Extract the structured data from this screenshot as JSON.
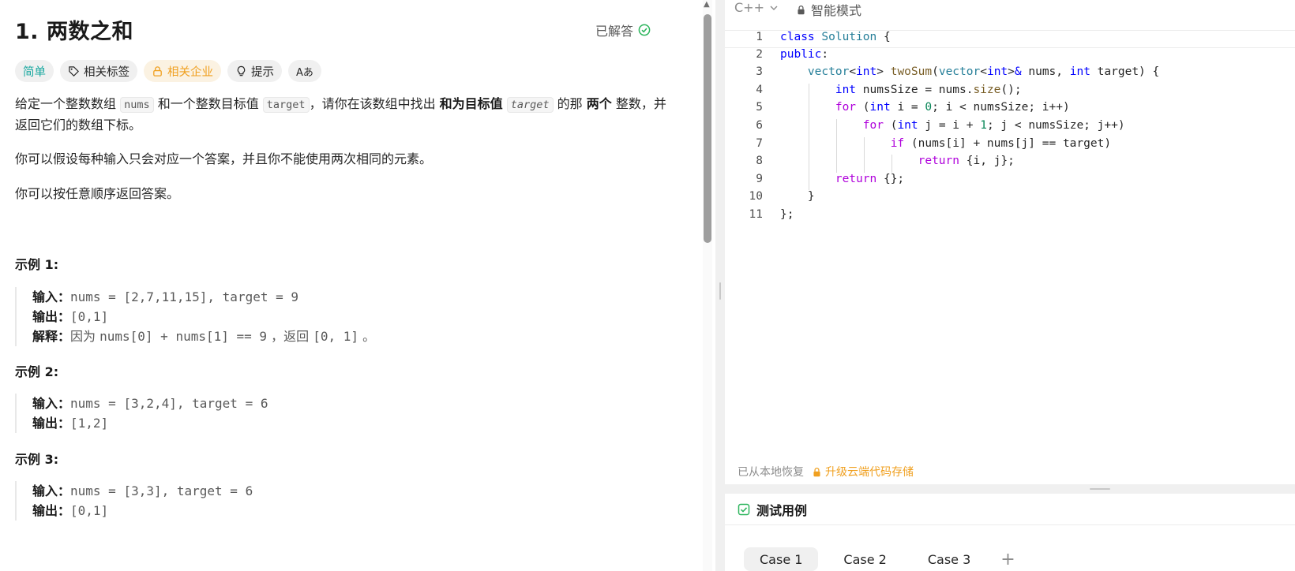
{
  "problem": {
    "title": "1. 两数之和",
    "solved_label": "已解答",
    "tags": {
      "difficulty": "简单",
      "related_tags": "相关标签",
      "related_companies": "相关企业",
      "hint": "提示",
      "translate_icon": "Aあ"
    },
    "desc": {
      "p1_a": "给定一个整数数组 ",
      "p1_nums": "nums",
      "p1_b": " 和一个整数目标值 ",
      "p1_target": "target",
      "p1_c": "，请你在该数组中找出 ",
      "p1_bold1": "和为目标值",
      "p1_d": " ",
      "p1_target2": "target",
      "p1_e": "  的那 ",
      "p1_bold2": "两个",
      "p1_f": " 整数，并返回它们的数组下标。",
      "p2": "你可以假设每种输入只会对应一个答案，并且你不能使用两次相同的元素。",
      "p3": "你可以按任意顺序返回答案。"
    },
    "examples": [
      {
        "title": "示例 1:",
        "input_label": "输入：",
        "input": "nums = [2,7,11,15], target = 9",
        "output_label": "输出：",
        "output": "[0,1]",
        "explain_label": "解释：",
        "explain_a": "因为 ",
        "explain_code": "nums[0] + nums[1] == 9",
        "explain_b": " ，返回 ",
        "explain_code2": "[0, 1]",
        "explain_c": " 。"
      },
      {
        "title": "示例 2:",
        "input_label": "输入：",
        "input": "nums = [3,2,4], target = 6",
        "output_label": "输出：",
        "output": "[1,2]"
      },
      {
        "title": "示例 3:",
        "input_label": "输入：",
        "input": "nums = [3,3], target = 6",
        "output_label": "输出：",
        "output": "[0,1]"
      }
    ]
  },
  "editor": {
    "language": "C++",
    "mode": "智能模式",
    "line_numbers": [
      "1",
      "2",
      "3",
      "4",
      "5",
      "6",
      "7",
      "8",
      "9",
      "10",
      "11"
    ],
    "restore_text": "已从本地恢复",
    "upgrade_text": "升级云端代码存储"
  },
  "testcases": {
    "header": "测试用例",
    "cases": [
      "Case 1",
      "Case 2",
      "Case 3"
    ],
    "add": "+"
  },
  "colors": {
    "easy": "#1aa8a0",
    "company": "#f0a020",
    "solved_check": "#2db55d",
    "keyword": "#0000ff",
    "type": "#267f99",
    "function": "#795e26",
    "number": "#098658",
    "control": "#af00db"
  }
}
